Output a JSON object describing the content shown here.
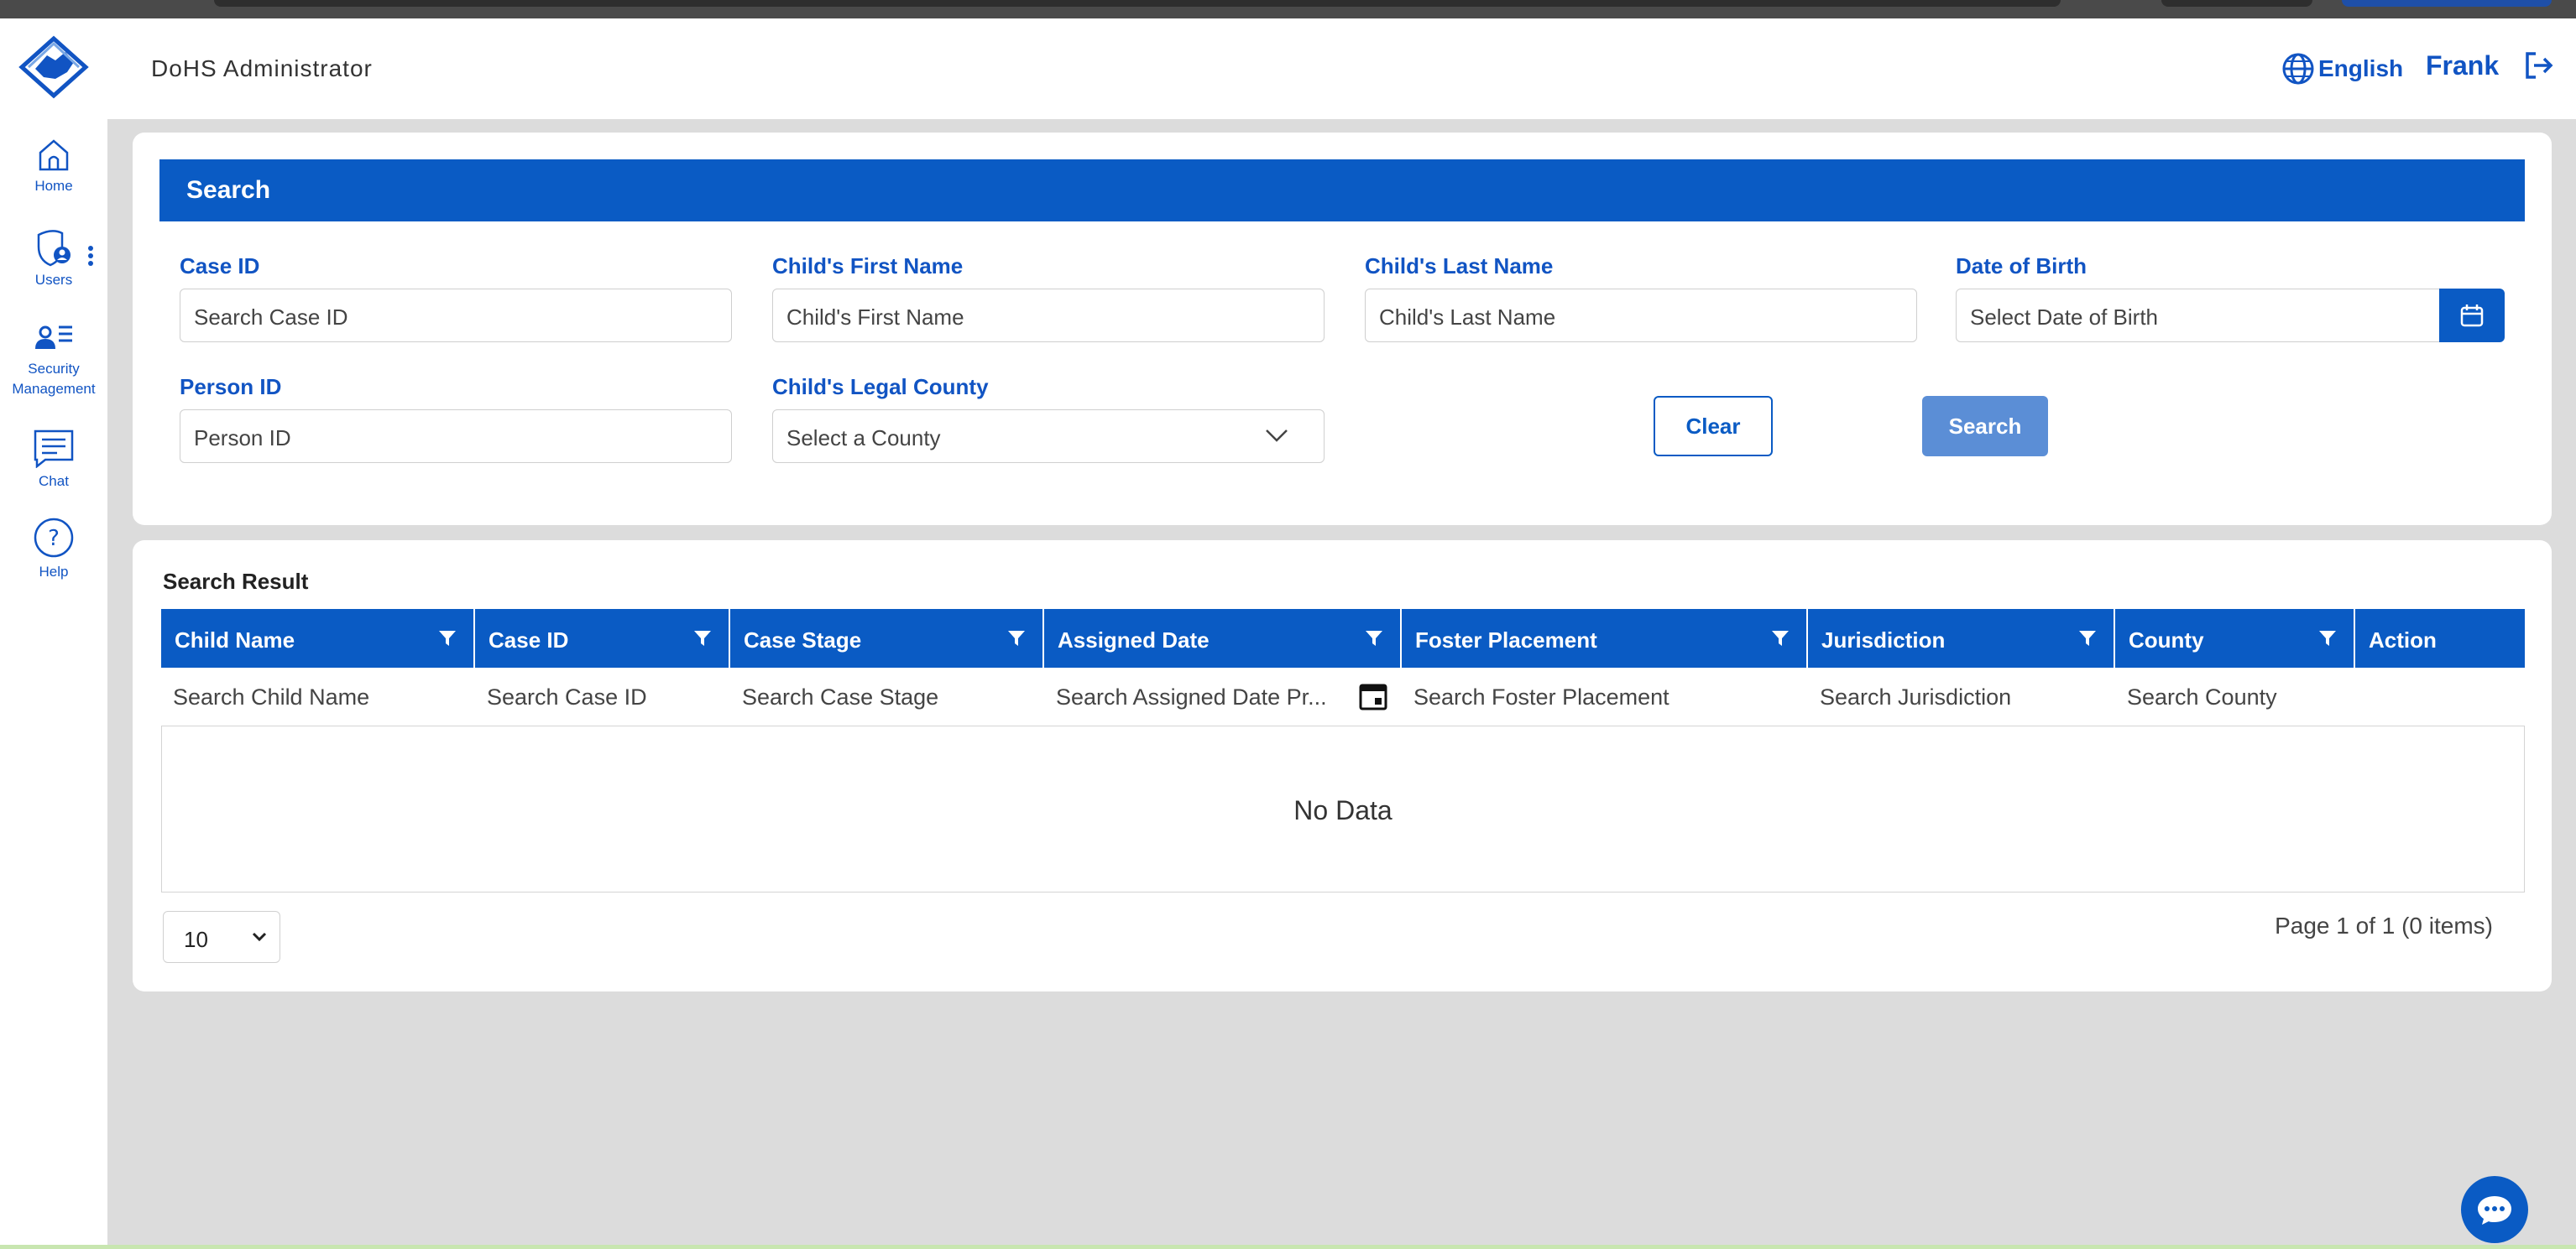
{
  "header": {
    "app_title": "DoHS Administrator",
    "language": "English",
    "user_name": "Frank"
  },
  "sidebar": {
    "items": [
      {
        "label": "Home",
        "icon": "home-icon"
      },
      {
        "label": "Users",
        "icon": "users-icon"
      },
      {
        "label": "Security Management",
        "icon": "security-management-icon"
      },
      {
        "label": "Chat",
        "icon": "chat-icon"
      },
      {
        "label": "Help",
        "icon": "help-icon"
      }
    ]
  },
  "search": {
    "title": "Search",
    "case_id": {
      "label": "Case ID",
      "placeholder": "Search Case ID"
    },
    "first_name": {
      "label": "Child's First Name",
      "placeholder": "Child's First Name"
    },
    "last_name": {
      "label": "Child's Last Name",
      "placeholder": "Child's Last Name"
    },
    "dob": {
      "label": "Date of Birth",
      "placeholder": "Select Date of Birth"
    },
    "person_id": {
      "label": "Person ID",
      "placeholder": "Person ID"
    },
    "county": {
      "label": "Child's Legal County",
      "placeholder": "Select a County"
    },
    "clear_label": "Clear",
    "search_label": "Search"
  },
  "results": {
    "title": "Search Result",
    "columns": [
      "Child Name",
      "Case ID",
      "Case Stage",
      "Assigned Date",
      "Foster Placement",
      "Jurisdiction",
      "County",
      "Action"
    ],
    "filters": [
      "Search Child Name",
      "Search Case ID",
      "Search Case Stage",
      "Search Assigned Date Pr...",
      "Search Foster Placement",
      "Search Jurisdiction",
      "Search County",
      ""
    ],
    "empty_text": "No Data",
    "page_size": "10",
    "page_info": "Page 1 of 1 (0 items)"
  },
  "colors": {
    "primary": "#0a5bc4",
    "search_button": "#5b8ed6",
    "background": "#dcdcdc"
  }
}
